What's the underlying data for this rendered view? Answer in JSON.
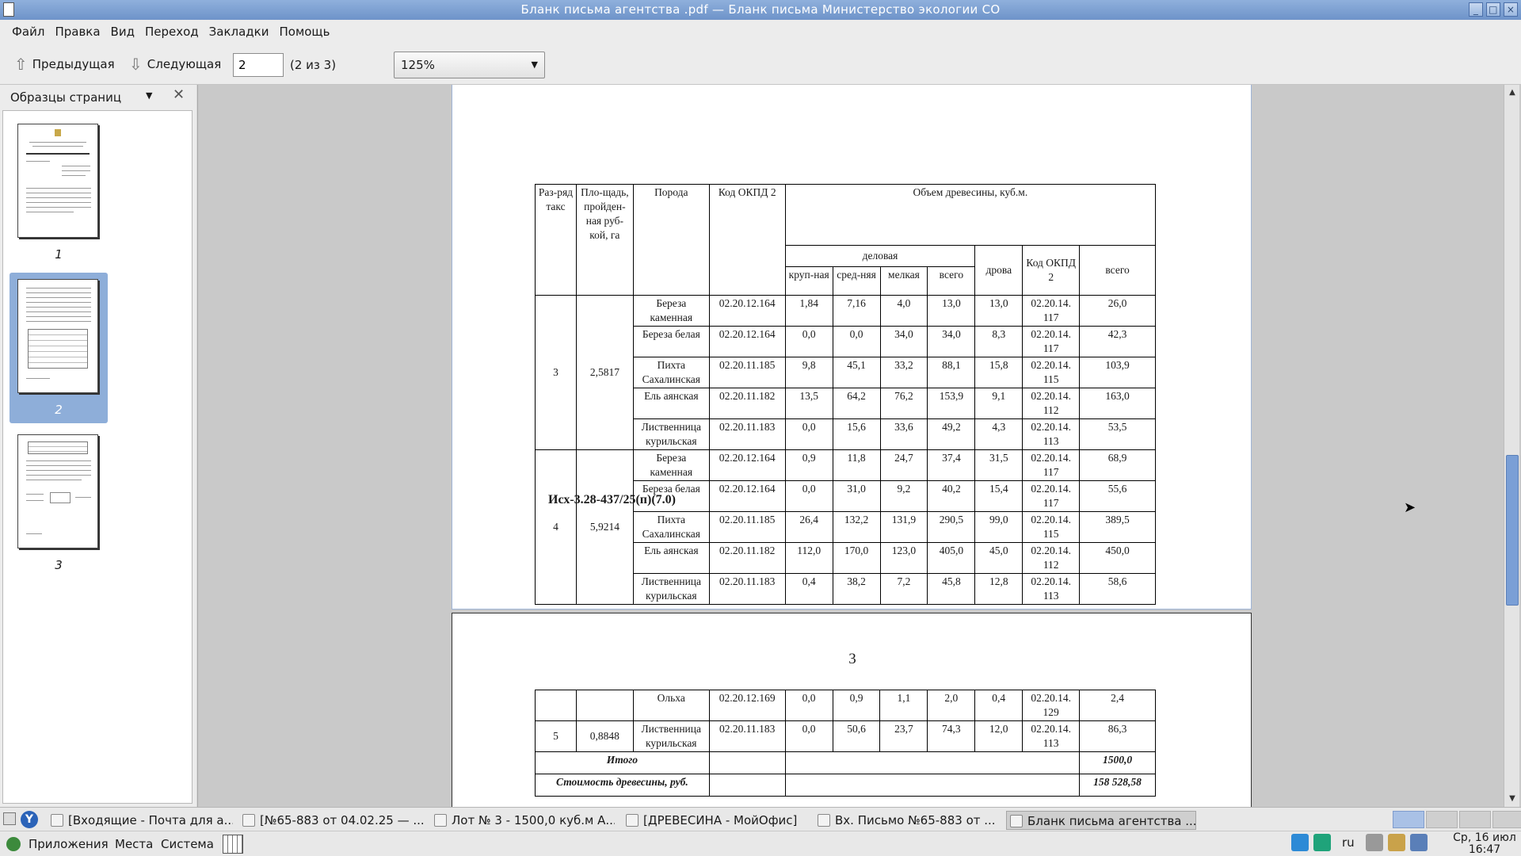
{
  "window": {
    "title": "Бланк письма агентства .pdf — Бланк письма Министерство экологии СО",
    "controls": [
      "_",
      "□",
      "×"
    ]
  },
  "menu": [
    "Файл",
    "Правка",
    "Вид",
    "Переход",
    "Закладки",
    "Помощь"
  ],
  "toolbar": {
    "prev_label": "Предыдущая",
    "next_label": "Следующая",
    "page_value": "2",
    "page_count": "(2 из 3)",
    "zoom": "125%"
  },
  "sidebar": {
    "title": "Образцы страниц",
    "thumbnails": [
      {
        "label": "1",
        "selected": false
      },
      {
        "label": "2",
        "selected": true
      },
      {
        "label": "3",
        "selected": false
      }
    ]
  },
  "document": {
    "header": {
      "col1": "Раз-ряд такс",
      "col2": "Пло-щадь, пройден-ная руб-кой, га",
      "col3": "Порода",
      "col4": "Код ОКПД 2",
      "volume": "Объем древесины, куб.м.",
      "business": "деловая",
      "sub": [
        "круп-ная",
        "сред-няя",
        "мелкая",
        "всего"
      ],
      "firewood": "дрова",
      "okpd": "Код ОКПД 2",
      "total": "всего"
    },
    "groups": [
      {
        "rank": "3",
        "area": "2,5817",
        "rows": [
          [
            "Береза каменная",
            "02.20.12.164",
            "1,84",
            "7,16",
            "4,0",
            "13,0",
            "13,0",
            "02.20.14. 117",
            "26,0"
          ],
          [
            "Береза белая",
            "02.20.12.164",
            "0,0",
            "0,0",
            "34,0",
            "34,0",
            "8,3",
            "02.20.14. 117",
            "42,3"
          ],
          [
            "Пихта Сахалинская",
            "02.20.11.185",
            "9,8",
            "45,1",
            "33,2",
            "88,1",
            "15,8",
            "02.20.14. 115",
            "103,9"
          ],
          [
            "Ель аянская",
            "02.20.11.182",
            "13,5",
            "64,2",
            "76,2",
            "153,9",
            "9,1",
            "02.20.14. 112",
            "163,0"
          ],
          [
            "Лиственница курильская",
            "02.20.11.183",
            "0,0",
            "15,6",
            "33,6",
            "49,2",
            "4,3",
            "02.20.14. 113",
            "53,5"
          ]
        ]
      },
      {
        "rank": "4",
        "area": "5,9214",
        "rows": [
          [
            "Береза каменная",
            "02.20.12.164",
            "0,9",
            "11,8",
            "24,7",
            "37,4",
            "31,5",
            "02.20.14. 117",
            "68,9"
          ],
          [
            "Береза белая",
            "02.20.12.164",
            "0,0",
            "31,0",
            "9,2",
            "40,2",
            "15,4",
            "02.20.14. 117",
            "55,6"
          ],
          [
            "Пихта Сахалинская",
            "02.20.11.185",
            "26,4",
            "132,2",
            "131,9",
            "290,5",
            "99,0",
            "02.20.14. 115",
            "389,5"
          ],
          [
            "Ель аянская",
            "02.20.11.182",
            "112,0",
            "170,0",
            "123,0",
            "405,0",
            "45,0",
            "02.20.14. 112",
            "450,0"
          ],
          [
            "Лиственница курильская",
            "02.20.11.183",
            "0,4",
            "38,2",
            "7,2",
            "45,8",
            "12,8",
            "02.20.14. 113",
            "58,6"
          ]
        ]
      }
    ],
    "ref": "Исх-3.28-437/25(п)(7.0)",
    "page3": {
      "number": "3",
      "rows": [
        {
          "rank": "",
          "area": "",
          "cells": [
            "Ольха",
            "02.20.12.169",
            "0,0",
            "0,9",
            "1,1",
            "2,0",
            "0,4",
            "02.20.14. 129",
            "2,4"
          ]
        },
        {
          "rank": "5",
          "area": "0,8848",
          "cells": [
            "Лиственница курильская",
            "02.20.11.183",
            "0,0",
            "50,6",
            "23,7",
            "74,3",
            "12,0",
            "02.20.14. 113",
            "86,3"
          ]
        }
      ],
      "total_label": "Итого",
      "total_value": "1500,0",
      "cost_label": "Стоимость древесины, руб.",
      "cost_value": "158 528,58"
    }
  },
  "taskbar": {
    "tasks": [
      "[Входящие - Почта для а...",
      "[№65-883 от 04.02.25 — ...",
      "Лот № 3 - 1500,0 куб.м А...",
      "[ДРЕВЕСИНА - МойОфис]",
      "Вх.  Письмо №65-883 от ...",
      "Бланк письма агентства ..."
    ]
  },
  "panel": {
    "menus": [
      "Приложения",
      "Места",
      "Система"
    ],
    "lang": "ru",
    "clock_date": "Ср, 16 июл",
    "clock_time": "16:47"
  },
  "colors": {
    "titlebar": "#7c9ed2",
    "selection": "#8eaed9",
    "scrollbar": "#7a9fd6"
  }
}
